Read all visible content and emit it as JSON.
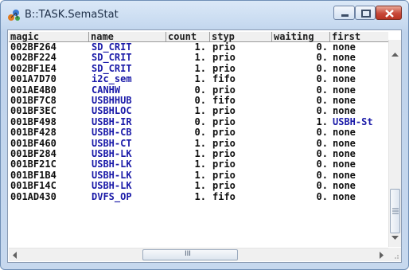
{
  "window": {
    "title": "B::TASK.SemaStat",
    "icons": {
      "app": "trace32-app-icon",
      "minimize": "minimize-icon",
      "maximize": "maximize-icon",
      "close": "close-icon"
    }
  },
  "table": {
    "columns": [
      "magic",
      "name",
      "count",
      "styp",
      "waiting",
      "first"
    ],
    "rows": [
      {
        "magic": "002BF264",
        "name": "SD_CRIT",
        "count": "1.",
        "styp": "prio",
        "waiting": "0.",
        "first": "none"
      },
      {
        "magic": "002BF224",
        "name": "SD_CRIT",
        "count": "1.",
        "styp": "prio",
        "waiting": "0.",
        "first": "none"
      },
      {
        "magic": "002BF1E4",
        "name": "SD_CRIT",
        "count": "1.",
        "styp": "prio",
        "waiting": "0.",
        "first": "none"
      },
      {
        "magic": "001A7D70",
        "name": "i2c_sem",
        "count": "1.",
        "styp": "fifo",
        "waiting": "0.",
        "first": "none"
      },
      {
        "magic": "001AE4B0",
        "name": "CANHW",
        "count": "0.",
        "styp": "prio",
        "waiting": "0.",
        "first": "none"
      },
      {
        "magic": "001BF7C8",
        "name": "USBHHUB",
        "count": "0.",
        "styp": "fifo",
        "waiting": "0.",
        "first": "none"
      },
      {
        "magic": "001BF3EC",
        "name": "USBHLOC",
        "count": "1.",
        "styp": "prio",
        "waiting": "0.",
        "first": "none"
      },
      {
        "magic": "001BF498",
        "name": "USBH-IR",
        "count": "0.",
        "styp": "prio",
        "waiting": "1.",
        "first": "USBH-St"
      },
      {
        "magic": "001BF428",
        "name": "USBH-CB",
        "count": "0.",
        "styp": "prio",
        "waiting": "0.",
        "first": "none"
      },
      {
        "magic": "001BF460",
        "name": "USBH-CT",
        "count": "1.",
        "styp": "prio",
        "waiting": "0.",
        "first": "none"
      },
      {
        "magic": "001BF284",
        "name": "USBH-LK",
        "count": "1.",
        "styp": "prio",
        "waiting": "0.",
        "first": "none"
      },
      {
        "magic": "001BF21C",
        "name": "USBH-LK",
        "count": "1.",
        "styp": "prio",
        "waiting": "0.",
        "first": "none"
      },
      {
        "magic": "001BF1B4",
        "name": "USBH-LK",
        "count": "1.",
        "styp": "prio",
        "waiting": "0.",
        "first": "none"
      },
      {
        "magic": "001BF14C",
        "name": "USBH-LK",
        "count": "1.",
        "styp": "prio",
        "waiting": "0.",
        "first": "none"
      },
      {
        "magic": "001AD430",
        "name": "DVFS_OP",
        "count": "1.",
        "styp": "fifo",
        "waiting": "0.",
        "first": "none"
      }
    ]
  },
  "scrollbars": {
    "vertical": {
      "up": "arrow-up-icon",
      "down": "arrow-down-icon",
      "grip": "grip-lines-icon"
    },
    "horizontal": {
      "left": "arrow-left-icon",
      "right": "arrow-right-icon",
      "grip_label": "III"
    }
  }
}
